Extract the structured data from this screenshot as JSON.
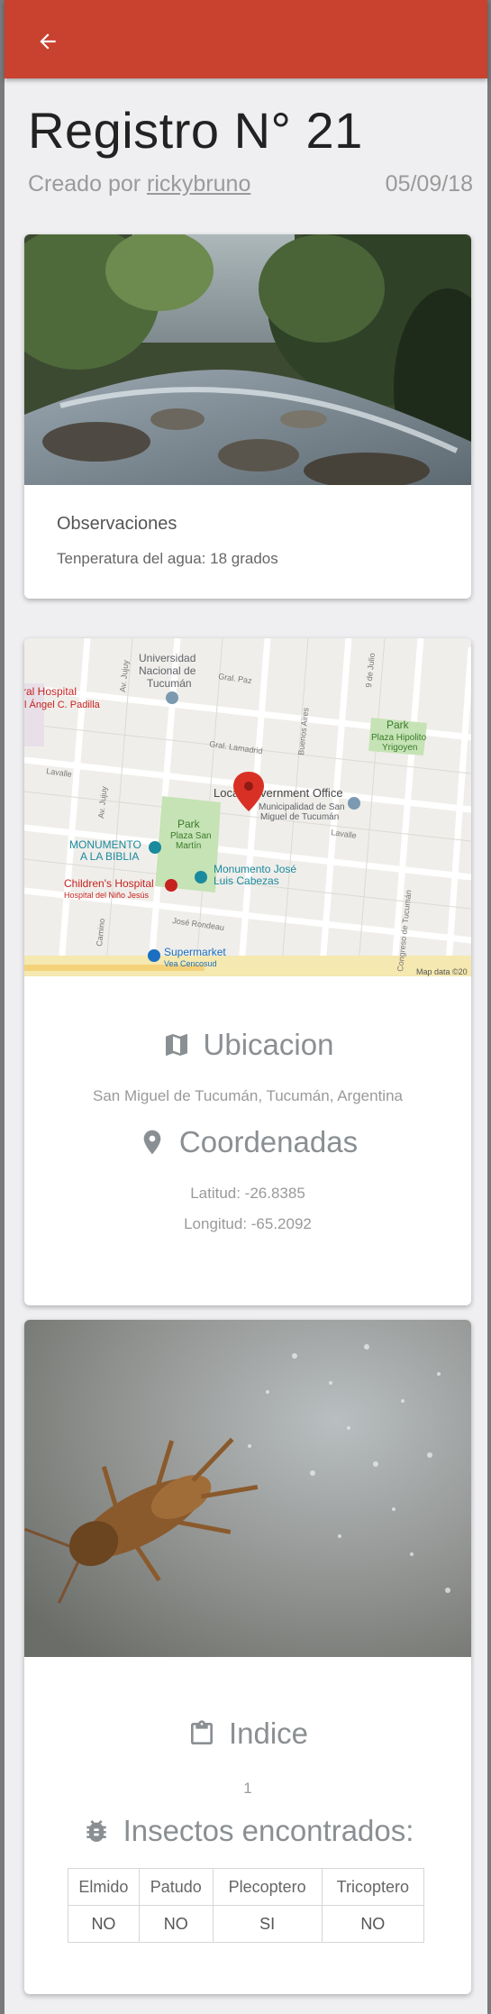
{
  "header": {
    "back_icon": "arrow-left-icon"
  },
  "record": {
    "title": "Registro N° 21",
    "created_by_prefix": "Creado por ",
    "author": "rickybruno",
    "date": "05/09/18"
  },
  "observations": {
    "heading": "Observaciones",
    "text": "Tenperatura del agua: 18 grados"
  },
  "map": {
    "labels": {
      "hospital": "ral Hospital",
      "hospital_sub": "l Ángel C. Padilla",
      "university": "Universidad",
      "university2": "Nacional de",
      "university3": "Tucumán",
      "park_top": "Park",
      "park_top_sub": "Plaza Hipolito",
      "park_top_sub2": "Yrigoyen",
      "gov_office": "Local Government Office",
      "municipalidad": "Municipalidad de San",
      "municipalidad2": "Miguel de Tucumán",
      "park_mid": "Park",
      "park_mid_sub": "Plaza San",
      "park_mid_sub2": "Martín",
      "monumento_biblia": "MONUMENTO",
      "monumento_biblia2": "A LA BIBLIA",
      "monumento_jose": "Monumento José",
      "monumento_jose2": "Luis Cabezas",
      "childrens": "Children's Hospital",
      "childrens_sub": "Hospital del Niño Jesús",
      "supermarket": "Supermarket",
      "supermarket_sub": "Vea Cencosud",
      "street_gral_paz": "Gral. Paz",
      "street_lamadrid": "Gral. Lamadrid",
      "street_lavalle": "Lavalle",
      "street_lavalle2": "Lavalle",
      "street_julio": "9 de Julio",
      "street_buenos_aires": "Buenos Aires",
      "street_jujuy": "Av. Jujuy",
      "street_jujuy2": "Av. Jujuy",
      "street_rondeau": "José Rondeau",
      "street_congreso": "Congreso de Tucumán",
      "street_camino": "Camino",
      "attribution": "Map data ©20"
    }
  },
  "location": {
    "heading": "Ubicacion",
    "heading_icon": "map-icon",
    "address": "San Miguel de Tucumán, Tucumán, Argentina",
    "coords_heading": "Coordenadas",
    "coords_icon": "location-pin-icon",
    "lat_label": "Latitud: -26.8385",
    "lon_label": "Longitud: -65.2092"
  },
  "index": {
    "heading": "Indice",
    "heading_icon": "clipboard-icon",
    "value": "1"
  },
  "insects": {
    "heading": "Insectos encontrados:",
    "heading_icon": "bug-icon",
    "columns": [
      "Elmido",
      "Patudo",
      "Plecoptero",
      "Tricoptero"
    ],
    "values": [
      "NO",
      "NO",
      "SI",
      "NO"
    ]
  },
  "colors": {
    "appbar": "#c9412f",
    "map_pin": "#d93025",
    "background": "#efeff1"
  }
}
